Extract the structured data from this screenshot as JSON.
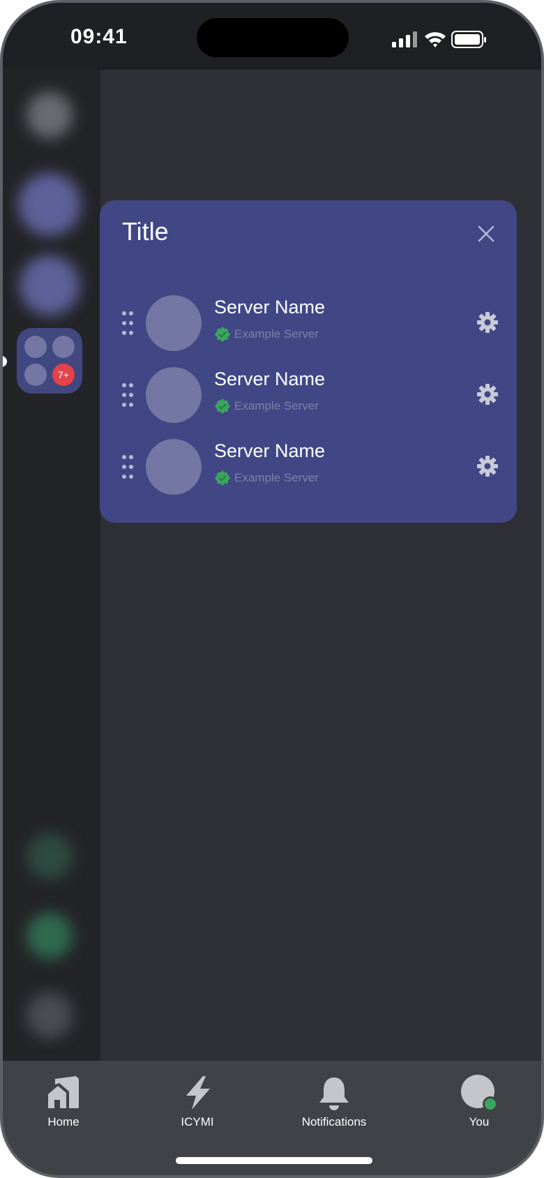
{
  "status_bar": {
    "time": "09:41"
  },
  "folder": {
    "badge": "7+"
  },
  "modal": {
    "title": "Title",
    "servers": [
      {
        "name": "Server Name",
        "subtitle": "Example Server"
      },
      {
        "name": "Server Name",
        "subtitle": "Example Server"
      },
      {
        "name": "Server Name",
        "subtitle": "Example Server"
      }
    ]
  },
  "tab_bar": {
    "tabs": [
      {
        "label": "Home",
        "icon": "home-icon"
      },
      {
        "label": "ICYMI",
        "icon": "lightning-icon"
      },
      {
        "label": "Notifications",
        "icon": "bell-icon"
      },
      {
        "label": "You",
        "icon": "avatar-icon"
      }
    ]
  },
  "colors": {
    "card": "#414785",
    "accent_green": "#3aa55d",
    "badge_red": "#e3424a",
    "tab_bar": "#3f4247"
  }
}
